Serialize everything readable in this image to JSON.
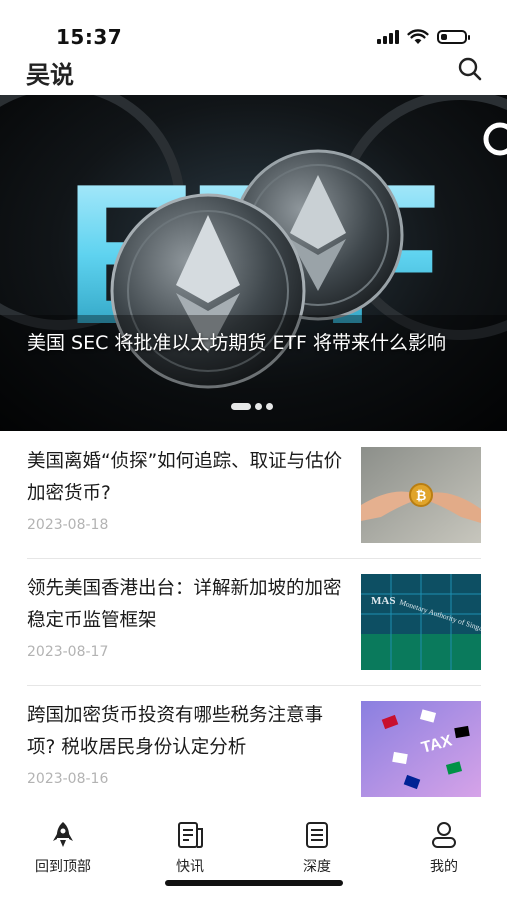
{
  "status_bar": {
    "time": "15:37",
    "battery_percent": 25
  },
  "header": {
    "title": "吴说",
    "search_icon": "search-icon"
  },
  "banner": {
    "big_text": "ETF",
    "caption": "美国 SEC 将批准以太坊期货 ETF 将带来什么影响",
    "page_count": 3,
    "active_index": 0
  },
  "news": [
    {
      "title": "美国离婚“侦探”如何追踪、取证与估价加密货币?",
      "date": "2023-08-18",
      "thumb": "hands-bitcoin"
    },
    {
      "title": "领先美国香港出台：详解新加坡的加密稳定币监管框架",
      "date": "2023-08-17",
      "thumb": "mas-building",
      "thumb_text": "Monetary Authority of Singapore"
    },
    {
      "title": "跨国加密货币投资有哪些税务注意事项? 税收居民身份认定分析",
      "date": "2023-08-16",
      "thumb": "tax-flags",
      "thumb_text": "TAX"
    }
  ],
  "tabbar": {
    "items": [
      {
        "label": "回到顶部",
        "icon": "rocket-icon"
      },
      {
        "label": "快讯",
        "icon": "newsflash-icon"
      },
      {
        "label": "深度",
        "icon": "document-icon"
      },
      {
        "label": "我的",
        "icon": "profile-icon"
      }
    ]
  },
  "colors": {
    "accent_cyan": "#5fd3f0",
    "date_gray": "#b3b3b3",
    "divider": "#e6e6e6"
  }
}
